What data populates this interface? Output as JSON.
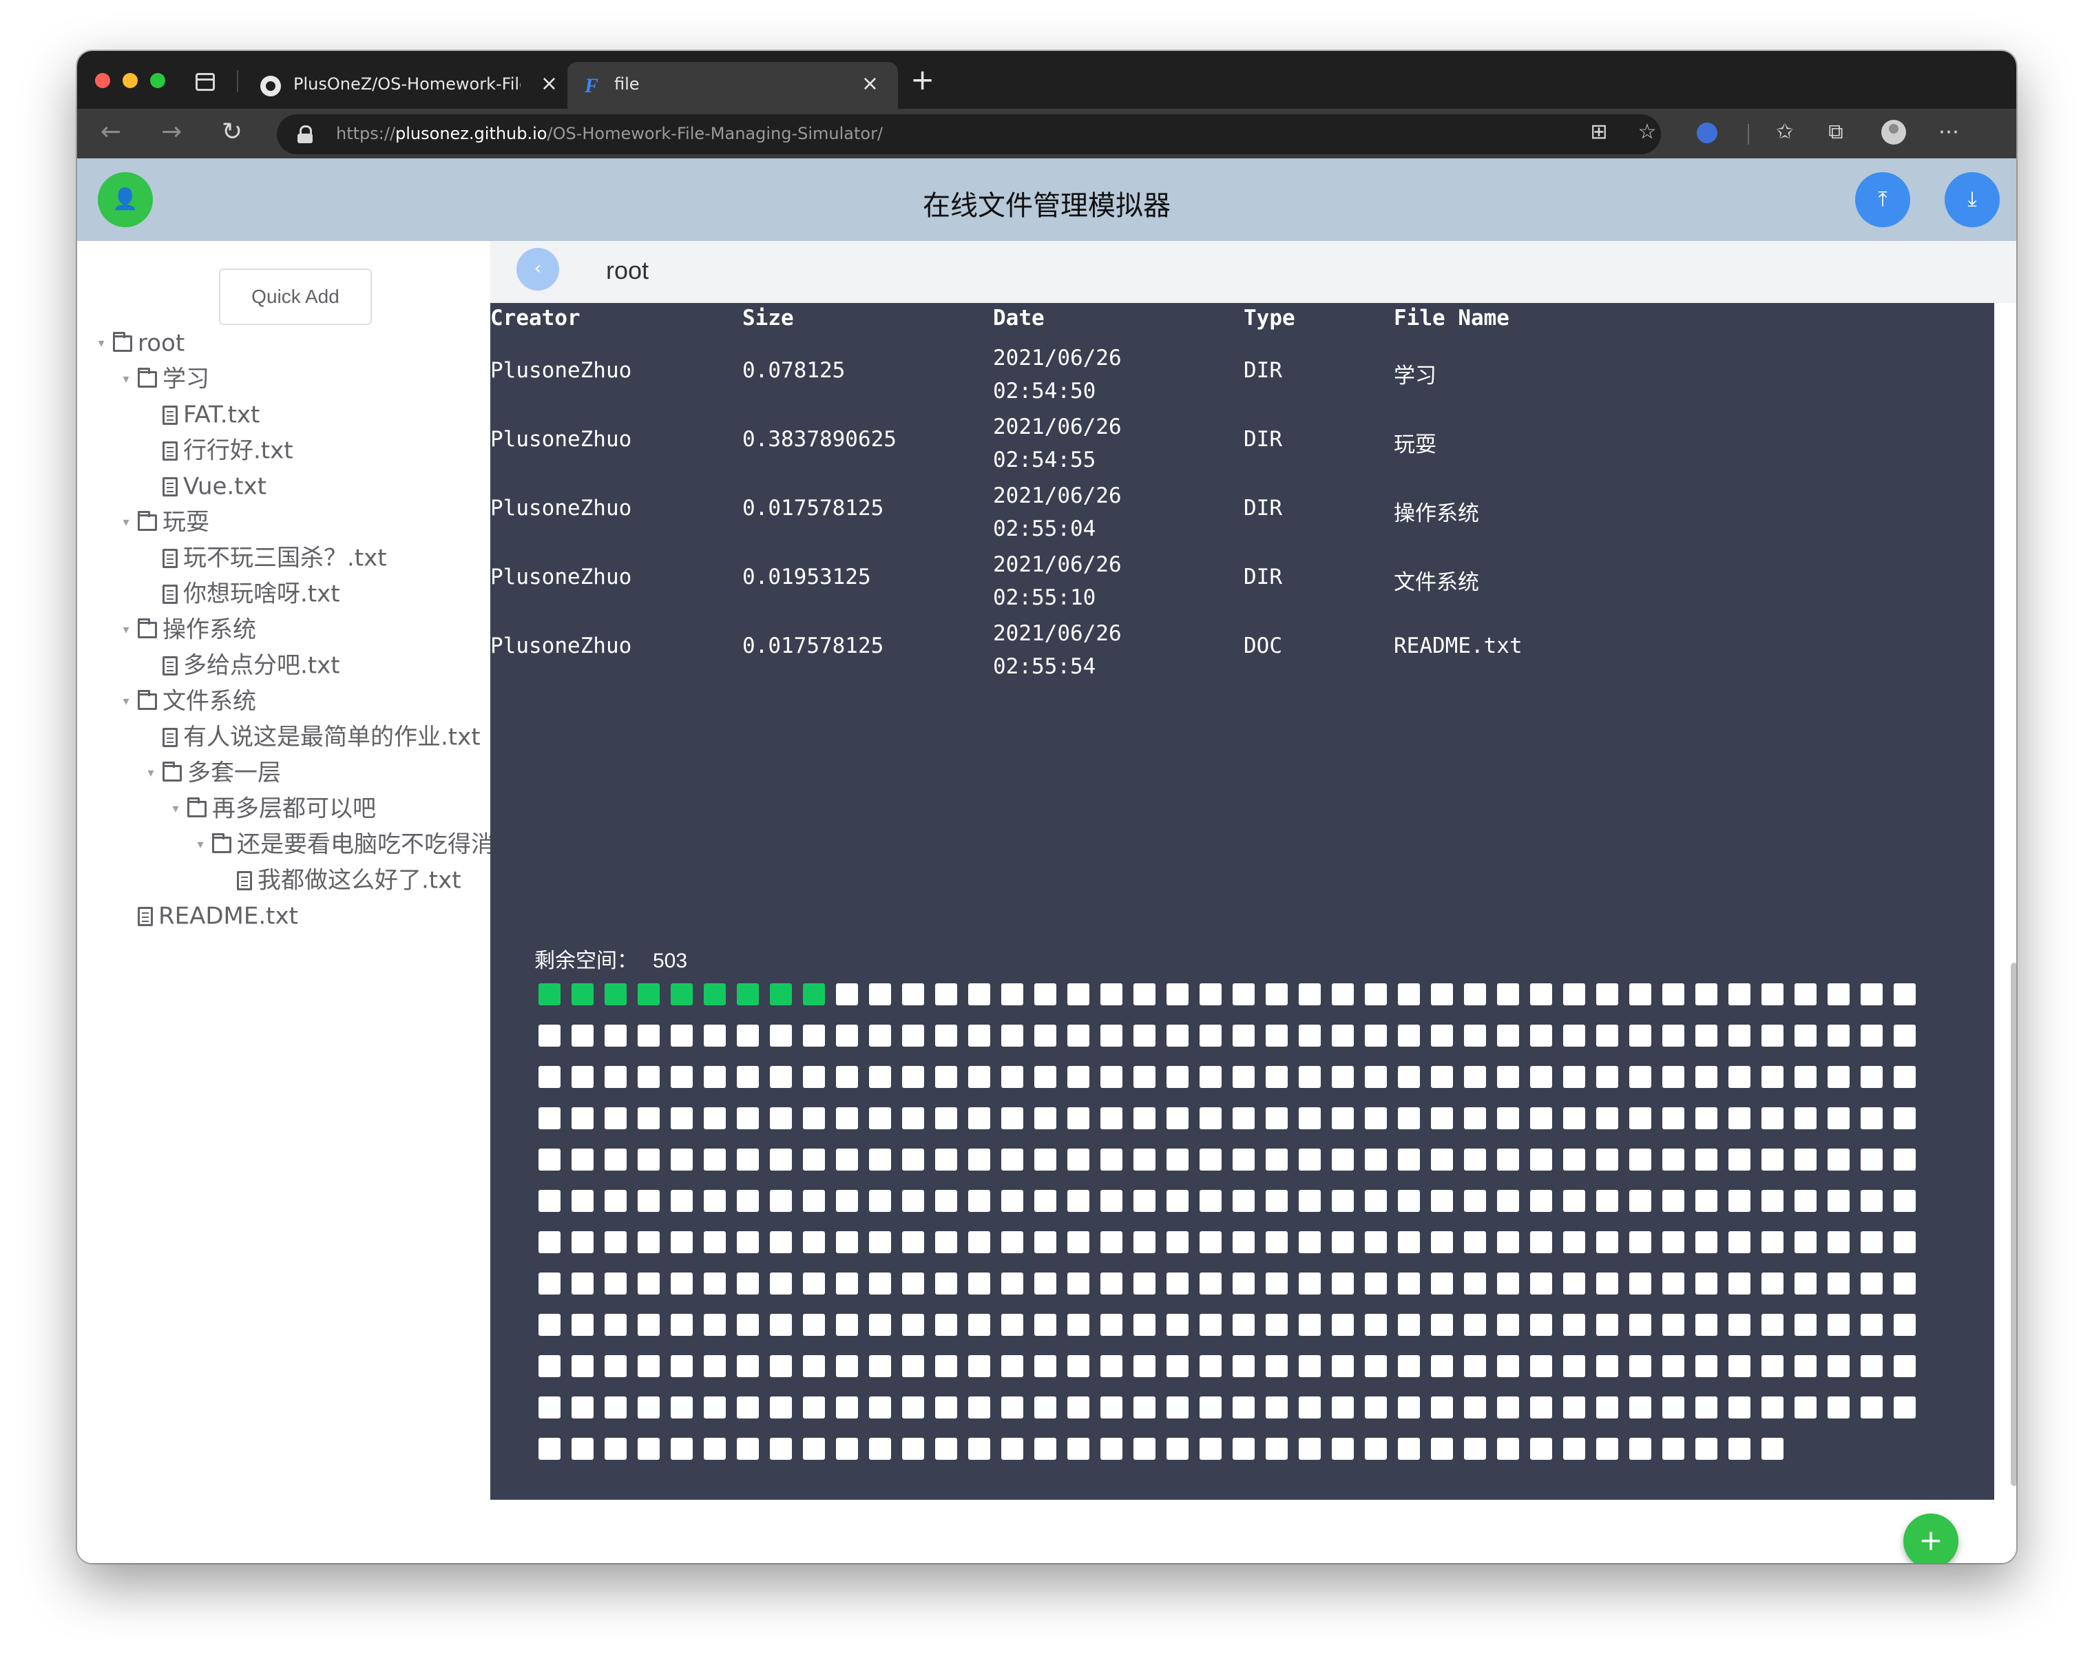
{
  "browser": {
    "tabs": [
      {
        "title": "PlusOneZ/OS-Homework-File-Managing-Simulator"
      },
      {
        "title": "file"
      }
    ],
    "url_scheme": "https://",
    "url_host": "plusonez.github.io",
    "url_path": "/OS-Homework-File-Managing-Simulator/"
  },
  "app": {
    "title": "在线文件管理模拟器",
    "quick_add_label": "Quick Add"
  },
  "tree": [
    {
      "label": "root",
      "type": "folder",
      "depth": 0,
      "expanded": true
    },
    {
      "label": "学习",
      "type": "folder",
      "depth": 1,
      "expanded": true
    },
    {
      "label": "FAT.txt",
      "type": "file",
      "depth": 2
    },
    {
      "label": "行行好.txt",
      "type": "file",
      "depth": 2
    },
    {
      "label": "Vue.txt",
      "type": "file",
      "depth": 2
    },
    {
      "label": "玩耍",
      "type": "folder",
      "depth": 1,
      "expanded": true
    },
    {
      "label": "玩不玩三国杀？.txt",
      "type": "file",
      "depth": 2
    },
    {
      "label": "你想玩啥呀.txt",
      "type": "file",
      "depth": 2
    },
    {
      "label": "操作系统",
      "type": "folder",
      "depth": 1,
      "expanded": true
    },
    {
      "label": "多给点分吧.txt",
      "type": "file",
      "depth": 2
    },
    {
      "label": "文件系统",
      "type": "folder",
      "depth": 1,
      "expanded": true
    },
    {
      "label": "有人说这是最简单的作业.txt",
      "type": "file",
      "depth": 2
    },
    {
      "label": "多套一层",
      "type": "folder",
      "depth": 2,
      "expanded": true
    },
    {
      "label": "再多层都可以吧",
      "type": "folder",
      "depth": 3,
      "expanded": true
    },
    {
      "label": "还是要看电脑吃不吃得消",
      "type": "folder",
      "depth": 4,
      "expanded": true
    },
    {
      "label": "我都做这么好了.txt",
      "type": "file",
      "depth": 5
    },
    {
      "label": "README.txt",
      "type": "file",
      "depth": 1
    }
  ],
  "path": {
    "current": "root"
  },
  "file_table": {
    "headers": [
      "Creator",
      "Size",
      "Date",
      "Type",
      "File Name"
    ],
    "rows": [
      {
        "creator": "PlusoneZhuo",
        "size": "0.078125",
        "date": "2021/06/26",
        "time": "02:54:50",
        "type": "DIR",
        "name": "学习"
      },
      {
        "creator": "PlusoneZhuo",
        "size": "0.3837890625",
        "date": "2021/06/26",
        "time": "02:54:55",
        "type": "DIR",
        "name": "玩耍"
      },
      {
        "creator": "PlusoneZhuo",
        "size": "0.017578125",
        "date": "2021/06/26",
        "time": "02:55:04",
        "type": "DIR",
        "name": "操作系统"
      },
      {
        "creator": "PlusoneZhuo",
        "size": "0.01953125",
        "date": "2021/06/26",
        "time": "02:55:10",
        "type": "DIR",
        "name": "文件系统"
      },
      {
        "creator": "PlusoneZhuo",
        "size": "0.017578125",
        "date": "2021/06/26",
        "time": "02:55:54",
        "type": "DOC",
        "name": "README.txt"
      }
    ]
  },
  "disk": {
    "label": "剩余空间：",
    "free_blocks": "503",
    "used_blocks": 9,
    "visible_blocks": 500,
    "blocks_per_row": 42,
    "used_color": "#13c95f",
    "free_color": "#ffffff"
  },
  "icons": {
    "user": "user-icon",
    "upload": "upload-icon",
    "download": "download-icon",
    "back": "chevron-left-icon",
    "add": "plus-icon",
    "info": "info-icon"
  },
  "colors": {
    "appbar": "#b8c9d9",
    "panel": "#3a3f51",
    "accent_blue": "#3d8ef0",
    "accent_green": "#33c24a"
  }
}
